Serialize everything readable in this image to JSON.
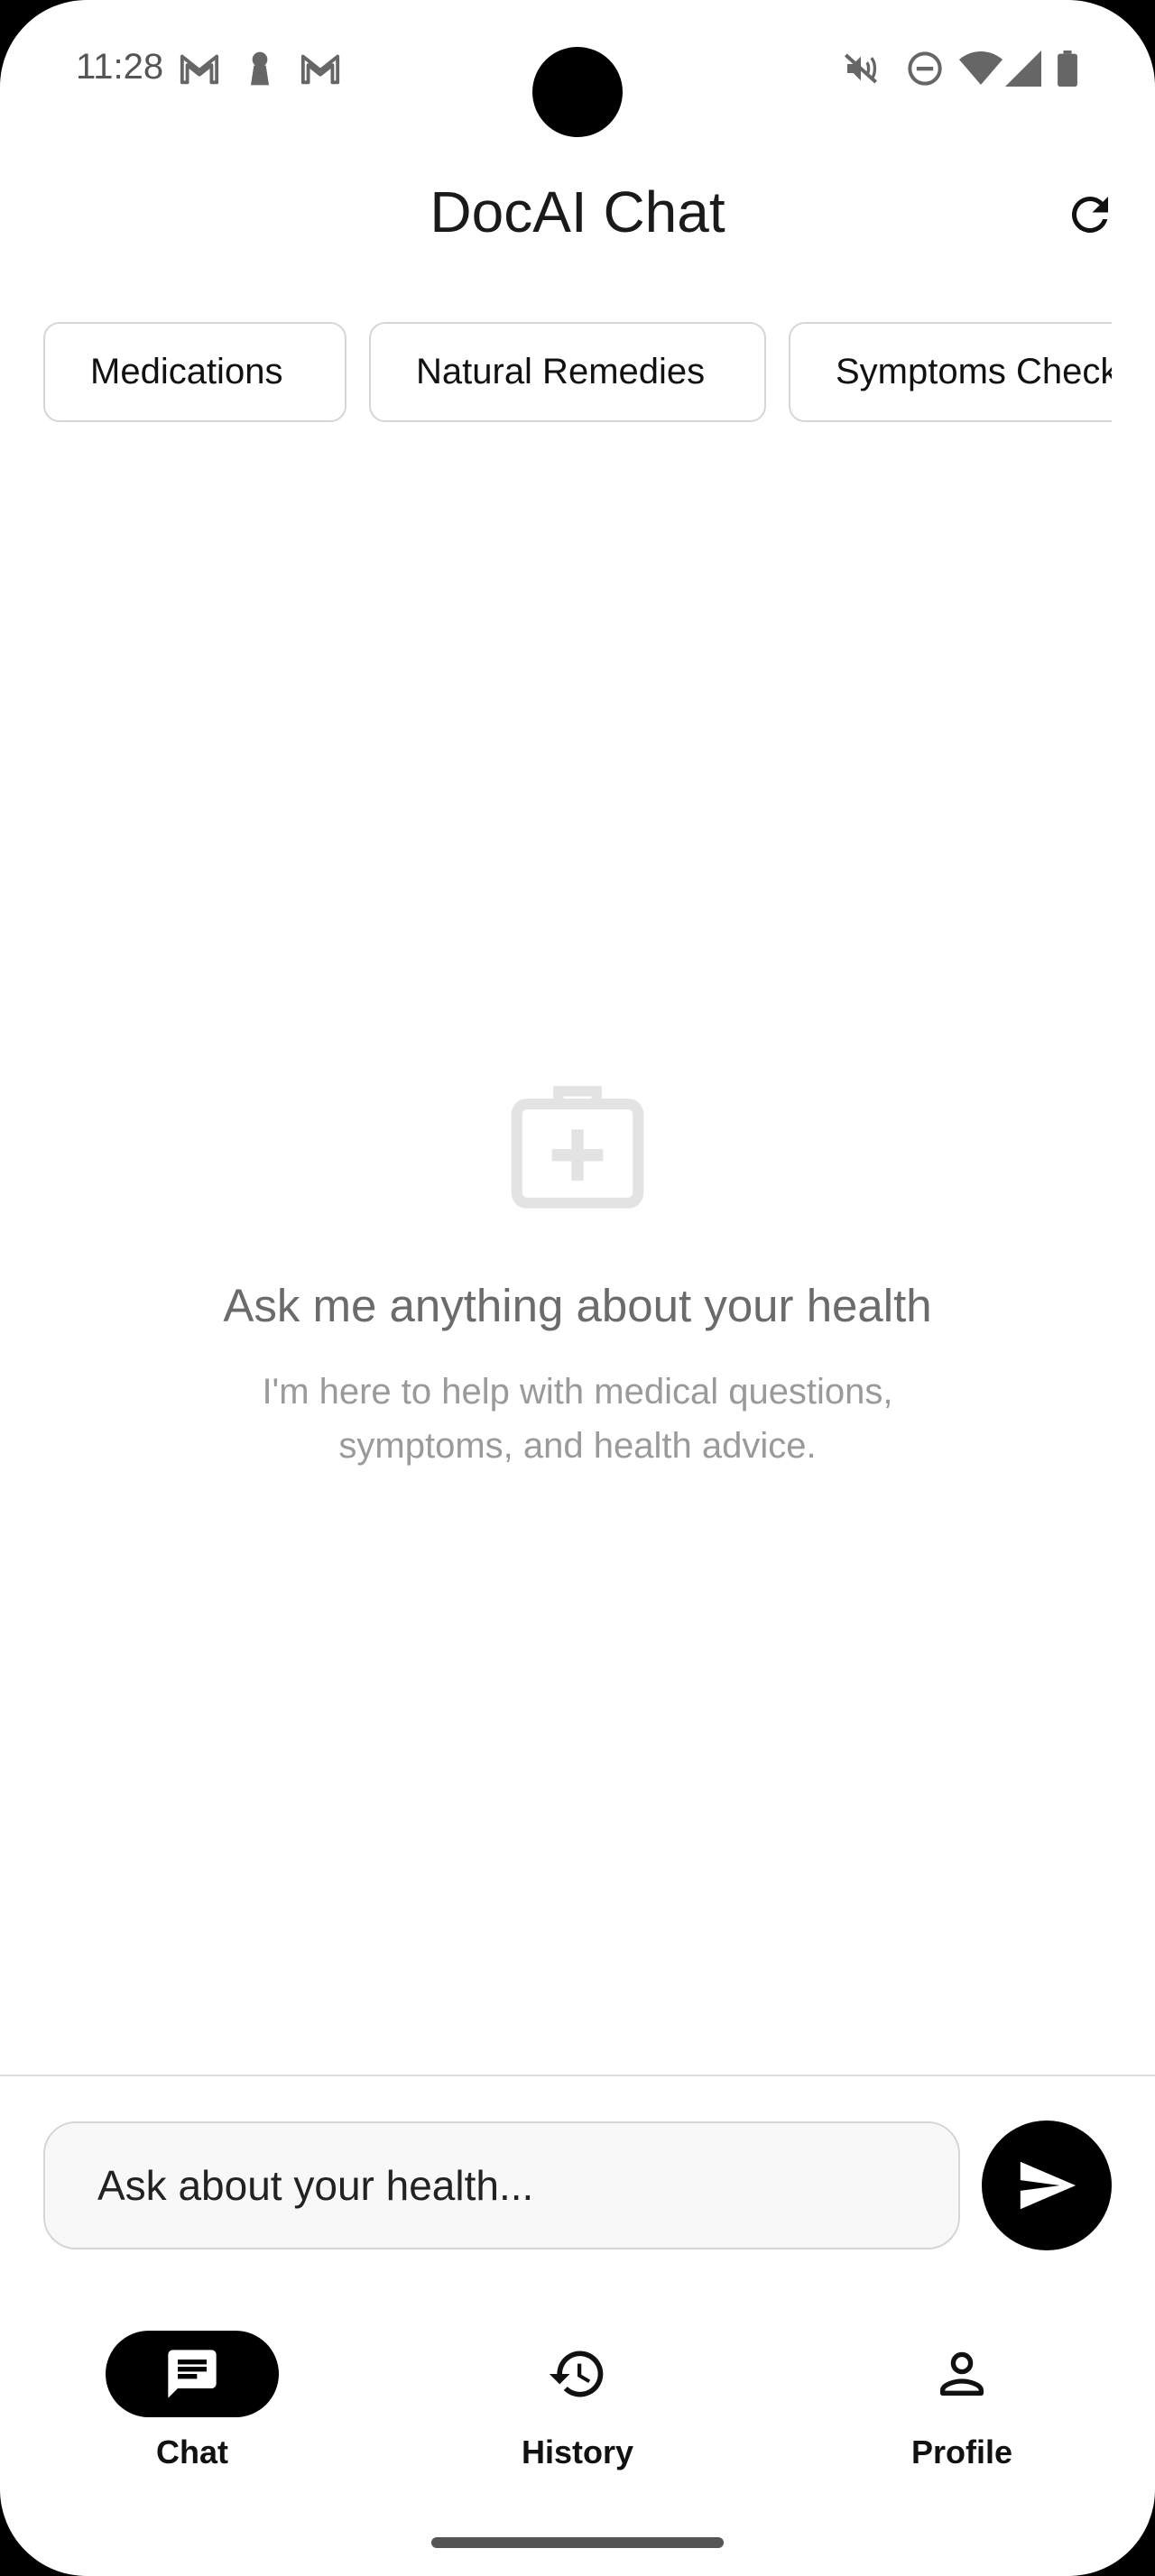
{
  "status_bar": {
    "time": "11:28",
    "icons": [
      "gmail-icon",
      "keyhole-icon",
      "gmail-icon",
      "mute-icon",
      "do-not-disturb-icon",
      "wifi-icon",
      "cellular-signal-icon",
      "battery-icon"
    ]
  },
  "header": {
    "title": "DocAI Chat",
    "refresh_icon": "refresh-icon"
  },
  "chips": [
    {
      "label": "Medications"
    },
    {
      "label": "Natural Remedies"
    },
    {
      "label": "Symptoms Checker"
    }
  ],
  "empty_state": {
    "icon": "medical-kit-icon",
    "title": "Ask me anything about your health",
    "subtitle": "I'm here to help with medical questions, symptoms, and health advice."
  },
  "composer": {
    "placeholder": "Ask about your health...",
    "send_icon": "send-icon"
  },
  "bottom_nav": {
    "items": [
      {
        "label": "Chat",
        "icon": "chat-icon",
        "active": true
      },
      {
        "label": "History",
        "icon": "history-icon",
        "active": false
      },
      {
        "label": "Profile",
        "icon": "person-icon",
        "active": false
      }
    ]
  },
  "colors": {
    "accent": "#000000",
    "muted_text": "#6b6b6b",
    "light_text": "#9a9a9a",
    "border": "#d6d6d6"
  }
}
